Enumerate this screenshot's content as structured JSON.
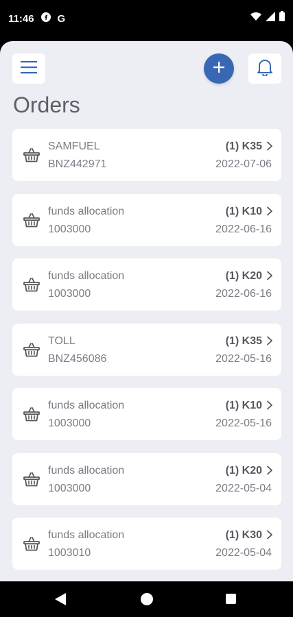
{
  "status_bar": {
    "time": "11:46",
    "icons": [
      "facebook-icon",
      "google-icon",
      "wifi-icon",
      "signal-icon",
      "battery-icon"
    ]
  },
  "header": {
    "menu_icon": "hamburger-icon",
    "add_icon": "plus-icon",
    "notification_icon": "bell-icon",
    "accent_color": "#3868b5"
  },
  "page": {
    "title": "Orders"
  },
  "orders": [
    {
      "name": "SAMFUEL",
      "ref": "BNZ442971",
      "amount": "(1) K35",
      "date": "2022-07-06"
    },
    {
      "name": "funds allocation",
      "ref": "1003000",
      "amount": "(1) K10",
      "date": "2022-06-16"
    },
    {
      "name": "funds allocation",
      "ref": "1003000",
      "amount": "(1) K20",
      "date": "2022-06-16"
    },
    {
      "name": "TOLL",
      "ref": "BNZ456086",
      "amount": "(1) K35",
      "date": "2022-05-16"
    },
    {
      "name": "funds allocation",
      "ref": "1003000",
      "amount": "(1) K10",
      "date": "2022-05-16"
    },
    {
      "name": "funds allocation",
      "ref": "1003000",
      "amount": "(1) K20",
      "date": "2022-05-04"
    },
    {
      "name": "funds allocation",
      "ref": "1003010",
      "amount": "(1) K30",
      "date": "2022-05-04"
    }
  ],
  "nav_bar": {
    "icons": [
      "back-icon",
      "home-icon",
      "recents-icon"
    ]
  }
}
